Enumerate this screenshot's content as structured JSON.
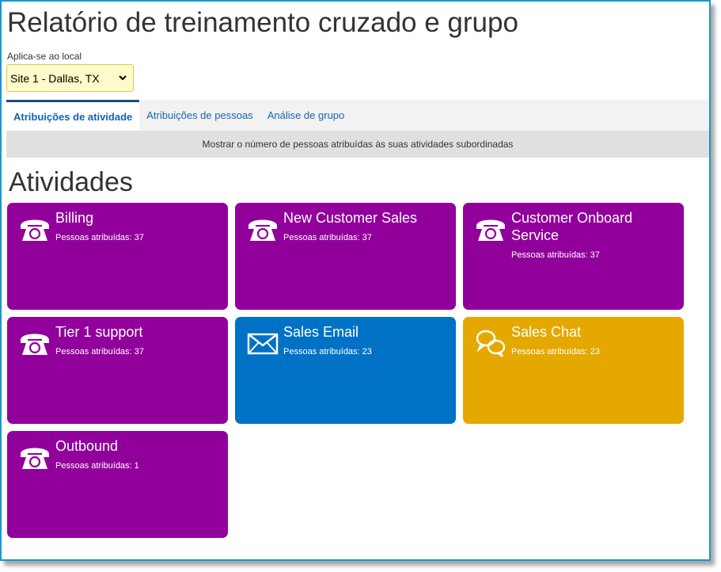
{
  "page": {
    "title": "Relatório de treinamento cruzado e grupo"
  },
  "location": {
    "label": "Aplica-se ao local",
    "selected": "Site 1 - Dallas, TX"
  },
  "tabs": [
    {
      "label": "Atribuições de atividade",
      "active": true
    },
    {
      "label": "Atribuições de pessoas",
      "active": false
    },
    {
      "label": "Análise de grupo",
      "active": false
    }
  ],
  "info": {
    "text": "Mostrar o número de pessoas atribuídas às suas atividades subordinadas"
  },
  "section": {
    "title": "Atividades"
  },
  "colors": {
    "purple": "#92009b",
    "blue": "#0072c6",
    "gold": "#e5a800"
  },
  "activities": [
    {
      "name": "Billing",
      "count_label": "Pessoas atribuídas: 37",
      "icon": "phone-icon",
      "color": "#92009b"
    },
    {
      "name": "New Customer Sales",
      "count_label": "Pessoas atribuídas: 37",
      "icon": "phone-icon",
      "color": "#92009b"
    },
    {
      "name": "Customer Onboard Service",
      "count_label": "Pessoas atribuídas: 37",
      "icon": "phone-icon",
      "color": "#92009b"
    },
    {
      "name": "Tier 1 support",
      "count_label": "Pessoas atribuídas: 37",
      "icon": "phone-icon",
      "color": "#92009b"
    },
    {
      "name": "Sales Email",
      "count_label": "Pessoas atribuídas: 23",
      "icon": "envelope-icon",
      "color": "#0072c6"
    },
    {
      "name": "Sales Chat",
      "count_label": "Pessoas atribuídas: 23",
      "icon": "chat-bubbles-icon",
      "color": "#e5a800"
    },
    {
      "name": "Outbound",
      "count_label": "Pessoas atribuídas: 1",
      "icon": "phone-icon",
      "color": "#92009b"
    }
  ]
}
